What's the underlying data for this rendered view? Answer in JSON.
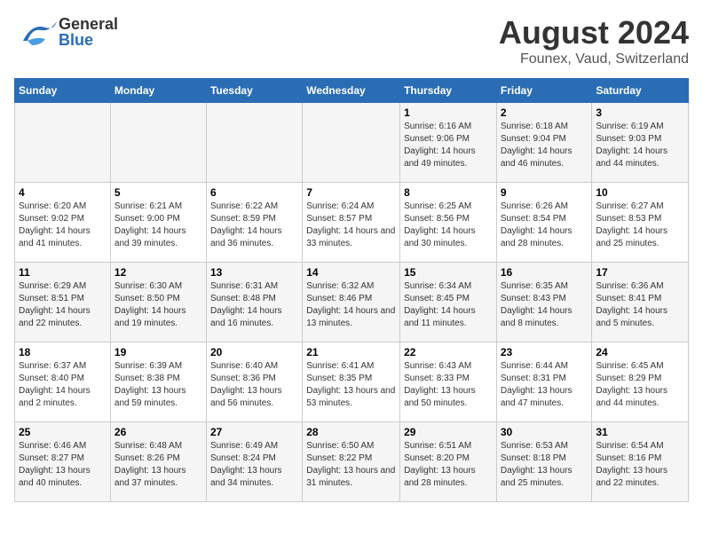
{
  "header": {
    "logo": {
      "general": "General",
      "blue": "Blue"
    },
    "month_title": "August 2024",
    "location": "Founex, Vaud, Switzerland"
  },
  "weekdays": [
    "Sunday",
    "Monday",
    "Tuesday",
    "Wednesday",
    "Thursday",
    "Friday",
    "Saturday"
  ],
  "weeks": [
    [
      {
        "day": "",
        "sunrise": "",
        "sunset": "",
        "daylight": ""
      },
      {
        "day": "",
        "sunrise": "",
        "sunset": "",
        "daylight": ""
      },
      {
        "day": "",
        "sunrise": "",
        "sunset": "",
        "daylight": ""
      },
      {
        "day": "",
        "sunrise": "",
        "sunset": "",
        "daylight": ""
      },
      {
        "day": "1",
        "sunrise": "Sunrise: 6:16 AM",
        "sunset": "Sunset: 9:06 PM",
        "daylight": "Daylight: 14 hours and 49 minutes."
      },
      {
        "day": "2",
        "sunrise": "Sunrise: 6:18 AM",
        "sunset": "Sunset: 9:04 PM",
        "daylight": "Daylight: 14 hours and 46 minutes."
      },
      {
        "day": "3",
        "sunrise": "Sunrise: 6:19 AM",
        "sunset": "Sunset: 9:03 PM",
        "daylight": "Daylight: 14 hours and 44 minutes."
      }
    ],
    [
      {
        "day": "4",
        "sunrise": "Sunrise: 6:20 AM",
        "sunset": "Sunset: 9:02 PM",
        "daylight": "Daylight: 14 hours and 41 minutes."
      },
      {
        "day": "5",
        "sunrise": "Sunrise: 6:21 AM",
        "sunset": "Sunset: 9:00 PM",
        "daylight": "Daylight: 14 hours and 39 minutes."
      },
      {
        "day": "6",
        "sunrise": "Sunrise: 6:22 AM",
        "sunset": "Sunset: 8:59 PM",
        "daylight": "Daylight: 14 hours and 36 minutes."
      },
      {
        "day": "7",
        "sunrise": "Sunrise: 6:24 AM",
        "sunset": "Sunset: 8:57 PM",
        "daylight": "Daylight: 14 hours and 33 minutes."
      },
      {
        "day": "8",
        "sunrise": "Sunrise: 6:25 AM",
        "sunset": "Sunset: 8:56 PM",
        "daylight": "Daylight: 14 hours and 30 minutes."
      },
      {
        "day": "9",
        "sunrise": "Sunrise: 6:26 AM",
        "sunset": "Sunset: 8:54 PM",
        "daylight": "Daylight: 14 hours and 28 minutes."
      },
      {
        "day": "10",
        "sunrise": "Sunrise: 6:27 AM",
        "sunset": "Sunset: 8:53 PM",
        "daylight": "Daylight: 14 hours and 25 minutes."
      }
    ],
    [
      {
        "day": "11",
        "sunrise": "Sunrise: 6:29 AM",
        "sunset": "Sunset: 8:51 PM",
        "daylight": "Daylight: 14 hours and 22 minutes."
      },
      {
        "day": "12",
        "sunrise": "Sunrise: 6:30 AM",
        "sunset": "Sunset: 8:50 PM",
        "daylight": "Daylight: 14 hours and 19 minutes."
      },
      {
        "day": "13",
        "sunrise": "Sunrise: 6:31 AM",
        "sunset": "Sunset: 8:48 PM",
        "daylight": "Daylight: 14 hours and 16 minutes."
      },
      {
        "day": "14",
        "sunrise": "Sunrise: 6:32 AM",
        "sunset": "Sunset: 8:46 PM",
        "daylight": "Daylight: 14 hours and 13 minutes."
      },
      {
        "day": "15",
        "sunrise": "Sunrise: 6:34 AM",
        "sunset": "Sunset: 8:45 PM",
        "daylight": "Daylight: 14 hours and 11 minutes."
      },
      {
        "day": "16",
        "sunrise": "Sunrise: 6:35 AM",
        "sunset": "Sunset: 8:43 PM",
        "daylight": "Daylight: 14 hours and 8 minutes."
      },
      {
        "day": "17",
        "sunrise": "Sunrise: 6:36 AM",
        "sunset": "Sunset: 8:41 PM",
        "daylight": "Daylight: 14 hours and 5 minutes."
      }
    ],
    [
      {
        "day": "18",
        "sunrise": "Sunrise: 6:37 AM",
        "sunset": "Sunset: 8:40 PM",
        "daylight": "Daylight: 14 hours and 2 minutes."
      },
      {
        "day": "19",
        "sunrise": "Sunrise: 6:39 AM",
        "sunset": "Sunset: 8:38 PM",
        "daylight": "Daylight: 13 hours and 59 minutes."
      },
      {
        "day": "20",
        "sunrise": "Sunrise: 6:40 AM",
        "sunset": "Sunset: 8:36 PM",
        "daylight": "Daylight: 13 hours and 56 minutes."
      },
      {
        "day": "21",
        "sunrise": "Sunrise: 6:41 AM",
        "sunset": "Sunset: 8:35 PM",
        "daylight": "Daylight: 13 hours and 53 minutes."
      },
      {
        "day": "22",
        "sunrise": "Sunrise: 6:43 AM",
        "sunset": "Sunset: 8:33 PM",
        "daylight": "Daylight: 13 hours and 50 minutes."
      },
      {
        "day": "23",
        "sunrise": "Sunrise: 6:44 AM",
        "sunset": "Sunset: 8:31 PM",
        "daylight": "Daylight: 13 hours and 47 minutes."
      },
      {
        "day": "24",
        "sunrise": "Sunrise: 6:45 AM",
        "sunset": "Sunset: 8:29 PM",
        "daylight": "Daylight: 13 hours and 44 minutes."
      }
    ],
    [
      {
        "day": "25",
        "sunrise": "Sunrise: 6:46 AM",
        "sunset": "Sunset: 8:27 PM",
        "daylight": "Daylight: 13 hours and 40 minutes."
      },
      {
        "day": "26",
        "sunrise": "Sunrise: 6:48 AM",
        "sunset": "Sunset: 8:26 PM",
        "daylight": "Daylight: 13 hours and 37 minutes."
      },
      {
        "day": "27",
        "sunrise": "Sunrise: 6:49 AM",
        "sunset": "Sunset: 8:24 PM",
        "daylight": "Daylight: 13 hours and 34 minutes."
      },
      {
        "day": "28",
        "sunrise": "Sunrise: 6:50 AM",
        "sunset": "Sunset: 8:22 PM",
        "daylight": "Daylight: 13 hours and 31 minutes."
      },
      {
        "day": "29",
        "sunrise": "Sunrise: 6:51 AM",
        "sunset": "Sunset: 8:20 PM",
        "daylight": "Daylight: 13 hours and 28 minutes."
      },
      {
        "day": "30",
        "sunrise": "Sunrise: 6:53 AM",
        "sunset": "Sunset: 8:18 PM",
        "daylight": "Daylight: 13 hours and 25 minutes."
      },
      {
        "day": "31",
        "sunrise": "Sunrise: 6:54 AM",
        "sunset": "Sunset: 8:16 PM",
        "daylight": "Daylight: 13 hours and 22 minutes."
      }
    ]
  ]
}
